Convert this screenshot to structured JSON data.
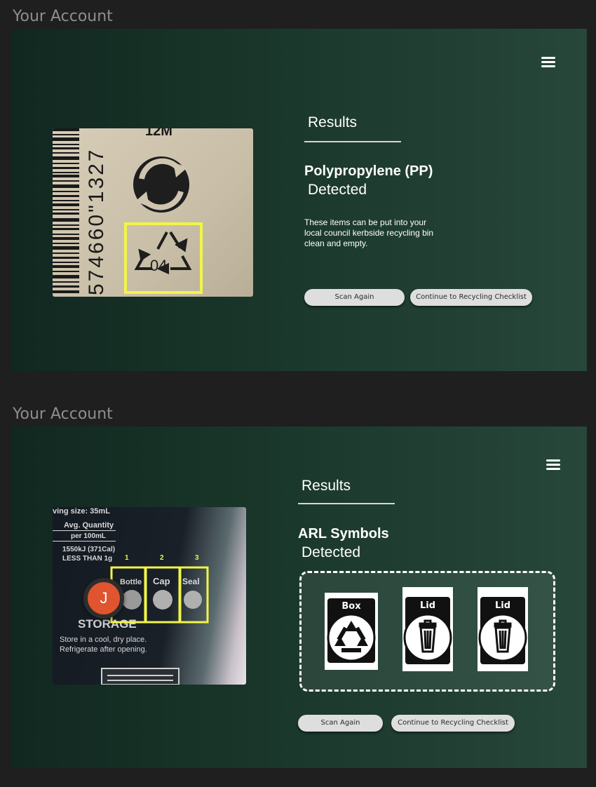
{
  "frames": [
    {
      "label": "Your Account",
      "results_heading": "Results",
      "material": "Polypropylene (PP)",
      "detected": "Detected",
      "info_text": "These items can be put into your local council kerbside recycling bin clean and empty.",
      "photo": {
        "top_text": "12M",
        "barcode_digits": "574660\"1327",
        "recycle_code": "04"
      },
      "buttons": {
        "scan_again": "Scan Again",
        "continue": "Continue to Recycling Checklist"
      }
    },
    {
      "label": "Your Account",
      "results_heading": "Results",
      "material": "ARL Symbols",
      "detected": "Detected",
      "photo": {
        "serving": "ving size: 35mL",
        "avg_qty": "Avg. Quantity",
        "per_100": "per 100mL",
        "energy": "1550kJ (371Cal)",
        "less_than": "LESS THAN 1g",
        "storage": "STORAGE",
        "storage_text_1": "Store in a cool, dry place.",
        "storage_text_2": "Refrigerate after opening.",
        "regions": [
          {
            "number": "1",
            "label": "Bottle"
          },
          {
            "number": "2",
            "label": "Cap"
          },
          {
            "number": "3",
            "label": "Seal"
          }
        ]
      },
      "avatar_initial": "J",
      "arl_symbols": [
        {
          "label": "Box",
          "icon": "recycle-icon"
        },
        {
          "label": "Lid",
          "icon": "trash-bin-icon"
        },
        {
          "label": "Lid",
          "icon": "trash-bin-icon"
        }
      ],
      "buttons": {
        "scan_again": "Scan Again",
        "continue": "Continue to Recycling Checklist"
      }
    }
  ]
}
